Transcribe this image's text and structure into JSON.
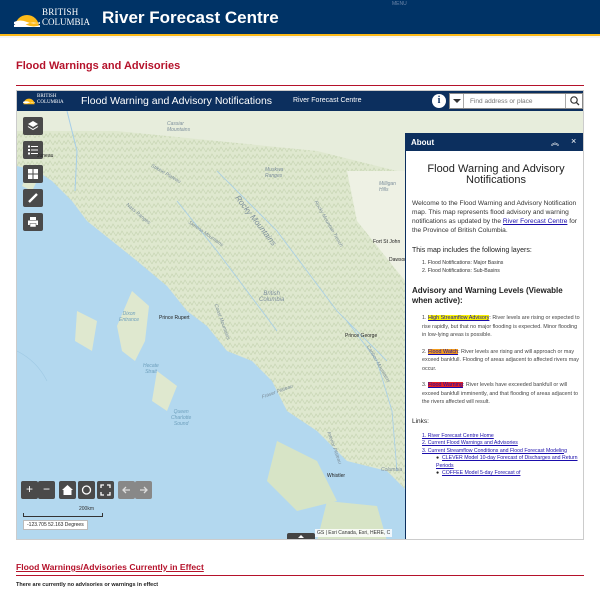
{
  "site_header": {
    "logo_line1": "BRITISH",
    "logo_line2": "COLUMBIA",
    "title": "River Forecast Centre",
    "menu_label": "MENU"
  },
  "page": {
    "heading": "Flood Warnings and Advisories"
  },
  "map_app": {
    "logo_line1": "BRITISH",
    "logo_line2": "COLUMBIA",
    "title": "Flood Warning and Advisory Notifications",
    "subtitle": "River Forecast Centre",
    "info_label": "i",
    "search_placeholder": "Find address or place",
    "tools": [
      "layers-icon",
      "legend-icon",
      "basemap-icon",
      "measure-icon",
      "print-icon"
    ],
    "zoom_in": "+",
    "zoom_out": "−",
    "scale_label": "200km",
    "coordinates": "-123.705 52.163 Degrees",
    "attribution": "GS | Esri Canada, Esri, HERE, C",
    "places": {
      "cassiar": "Cassiar\nMountains",
      "juneau": "Juneau",
      "muskwa": "Muskwa\nRanges",
      "stikine": "Stikine Plateau",
      "skeena": "Skeena Mountains",
      "rocky": "Rocky Mountains",
      "rocky_trench": "Rocky Mountain Trench",
      "milligan": "Milligan\nHills",
      "fort_st_john": "Fort St John",
      "dawson": "Dawson Creek",
      "bc": "British\nColumbia",
      "prince_rupert": "Prince Rupert",
      "dixon": "Dixon\nEntrance",
      "prince_george": "Prince George",
      "hecate": "Hecate\nStrait",
      "queen_charlotte": "Queen\nCharlotte\nSound",
      "fraser": "Fraser Plateau",
      "coast": "Coast Mountains",
      "cariboo": "Cariboo Mountains",
      "interior": "Interior Plateau",
      "whistler": "Whistler",
      "nass": "Nass Ranges",
      "columbia": "Columbia"
    }
  },
  "about_panel": {
    "header": "About",
    "title": "Flood Warning and Advisory Notifications",
    "intro_before": "Welcome to the Flood Warning and Advisory Notification map. This map represents flood advisory and warning notifications as updated by the ",
    "intro_link": "River Forecast Centre",
    "intro_after": " for the Province of British Columbia.",
    "layers_heading": "This map includes the following layers:",
    "layers": [
      "Flood Notifications: Major Basins",
      "Flood Notifications: Sub-Basins"
    ],
    "levels_heading": "Advisory and Warning Levels (Viewable when active):",
    "levels": [
      {
        "num": "1.",
        "name": "High Streamflow Advisory",
        "desc": ": River levels are rising or expected to rise rapidly, but that no major flooding is expected. Minor flooding in low-lying areas is possible."
      },
      {
        "num": "2.",
        "name": "Flood Watch",
        "desc": ": River levels are rising and will approach or may exceed bankfull. Flooding of areas adjacent to affected rivers may occur."
      },
      {
        "num": "3.",
        "name": "Flood Warning",
        "desc": ": River levels have exceeded bankfull or will exceed bankfull imminently, and that flooding of areas adjacent to the rivers affected will result."
      }
    ],
    "links_heading": "Links:",
    "links": [
      "1. River Forecast Centre Home",
      "2. Current Flood Warnings and Advisories",
      "3. Current Streamflow Conditions and Flood Forecast Modeling"
    ],
    "sublinks": [
      "CLEVER Model 10-day Forecast of Discharges and Return Periods",
      "COFFEE Model 5-day Forecast of"
    ]
  },
  "current": {
    "heading": "Flood Warnings/Advisories Currently in Effect",
    "message": "There are currently no advisories or warnings in effect"
  },
  "colors": {
    "header_blue": "#003366",
    "accent_gold": "#fcba19",
    "heading_red": "#b5122b"
  }
}
